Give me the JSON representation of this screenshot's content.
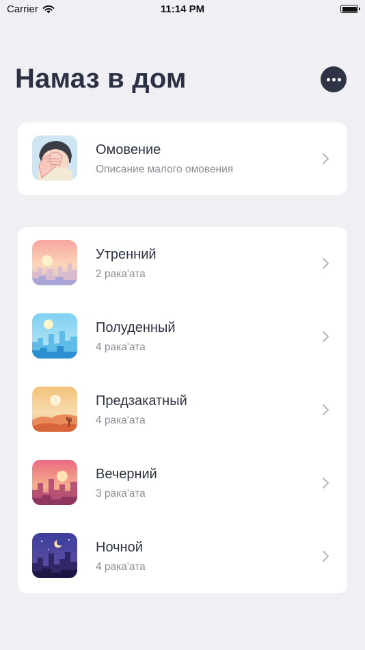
{
  "status_bar": {
    "carrier": "Carrier",
    "time": "11:14 PM"
  },
  "header": {
    "title": "Намаз в дом"
  },
  "ablution": {
    "title": "Омовение",
    "subtitle": "Описание малого омовения"
  },
  "prayers": [
    {
      "title": "Утренний",
      "subtitle": "2 рака'ата"
    },
    {
      "title": "Полуденный",
      "subtitle": "4 рака'ата"
    },
    {
      "title": "Предзакатный",
      "subtitle": "4 рака'ата"
    },
    {
      "title": "Вечерний",
      "subtitle": "3 рака'ата"
    },
    {
      "title": "Ночной",
      "subtitle": "4 рака'ата"
    }
  ],
  "colors": {
    "background": "#efeff4",
    "title": "#2b3142",
    "subtitle": "#8a8d95",
    "more_button": "#2e3445"
  },
  "icons": {
    "more": "ellipsis-icon",
    "chevron": "chevron-right-icon"
  }
}
